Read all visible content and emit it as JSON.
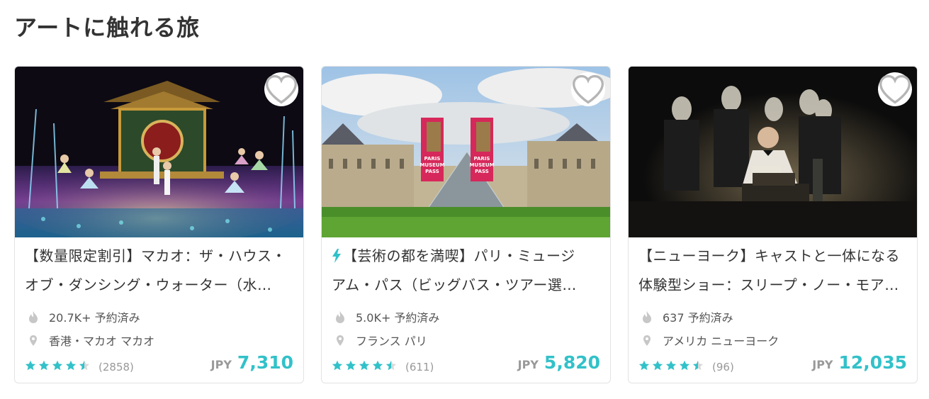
{
  "section": {
    "title": "アートに触れる旅"
  },
  "colors": {
    "accent": "#32c1c9",
    "star": "#32c1c9",
    "meta_icon": "#c7c7c7"
  },
  "cards": [
    {
      "title_line1": "【数量限定割引】マカオ：ザ・ハウス・",
      "title_line2": "オブ・ダンシング・ウォーター（水…",
      "has_bolt": false,
      "booked": "20.7K+ 予約済み",
      "location": "香港・マカオ マカオ",
      "rating": 4.5,
      "review_count": "(2858)",
      "currency": "JPY",
      "price": "7,310",
      "image": "show-stage-photo"
    },
    {
      "title_line1": "【芸術の都を満喫】パリ・ミュージ",
      "title_line2": "アム・パス（ビッグバス・ツアー選…",
      "has_bolt": true,
      "booked": "5.0K+ 予約済み",
      "location": "フランス パリ",
      "rating": 4.5,
      "review_count": "(611)",
      "currency": "JPY",
      "price": "5,820",
      "image": "louvre-museum-pass-photo",
      "pass_texts": [
        "PARIS",
        "MUSEUM",
        "PASS"
      ]
    },
    {
      "title_line1": "【ニューヨーク】キャストと一体になる",
      "title_line2": "体験型ショー：スリープ・ノー・モア…",
      "has_bolt": false,
      "booked": "637 予約済み",
      "location": "アメリカ ニューヨーク",
      "rating": 4.5,
      "review_count": "(96)",
      "currency": "JPY",
      "price": "12,035",
      "image": "masked-theater-photo"
    }
  ]
}
